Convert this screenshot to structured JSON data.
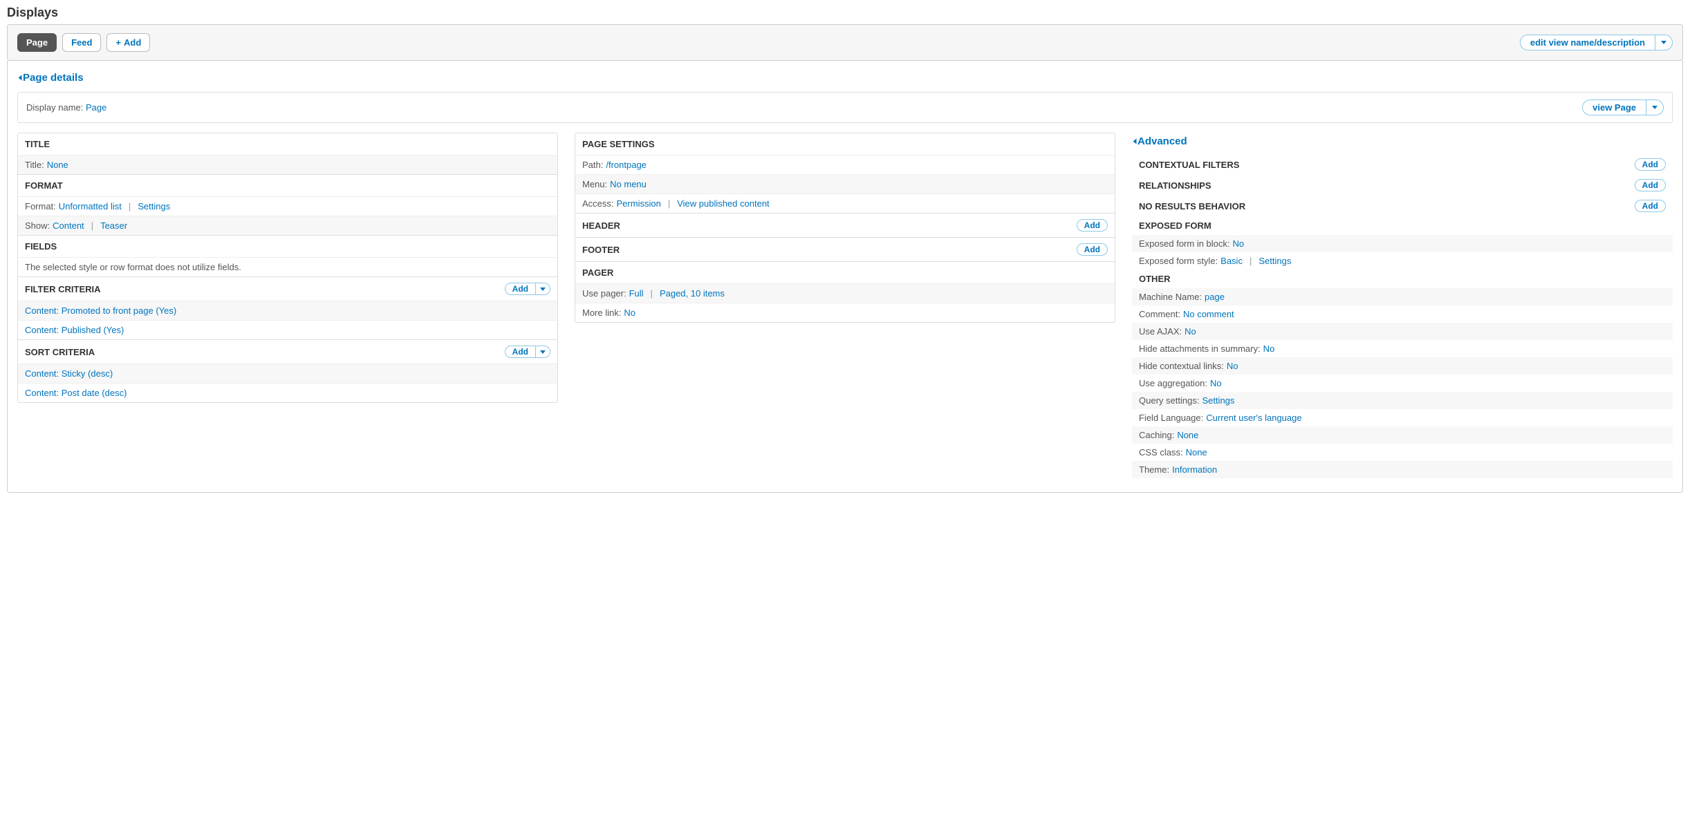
{
  "pageTitle": "Displays",
  "tabs": {
    "page": "Page",
    "feed": "Feed",
    "add": "Add"
  },
  "editViewBtn": "edit view name/description",
  "pageDetails": {
    "toggle": "Page details",
    "displayNameLabel": "Display name:",
    "displayNameValue": "Page",
    "viewPageBtn": "view Page"
  },
  "col1": {
    "title": {
      "head": "TITLE",
      "label": "Title:",
      "value": "None"
    },
    "format": {
      "head": "FORMAT",
      "formatLabel": "Format:",
      "formatValue": "Unformatted list",
      "formatSettings": "Settings",
      "showLabel": "Show:",
      "showValue": "Content",
      "showTeaser": "Teaser"
    },
    "fields": {
      "head": "FIELDS",
      "msg": "The selected style or row format does not utilize fields."
    },
    "filter": {
      "head": "FILTER CRITERIA",
      "addBtn": "Add",
      "item1": "Content: Promoted to front page (Yes)",
      "item2": "Content: Published (Yes)"
    },
    "sort": {
      "head": "SORT CRITERIA",
      "addBtn": "Add",
      "item1": "Content: Sticky (desc)",
      "item2": "Content: Post date (desc)"
    }
  },
  "col2": {
    "pageSettings": {
      "head": "PAGE SETTINGS",
      "pathLabel": "Path:",
      "pathValue": "/frontpage",
      "menuLabel": "Menu:",
      "menuValue": "No menu",
      "accessLabel": "Access:",
      "accessValue": "Permission",
      "accessPerm": "View published content"
    },
    "header": {
      "head": "HEADER",
      "addBtn": "Add"
    },
    "footer": {
      "head": "FOOTER",
      "addBtn": "Add"
    },
    "pager": {
      "head": "PAGER",
      "useLabel": "Use pager:",
      "useValue": "Full",
      "usePaged": "Paged, 10 items",
      "moreLabel": "More link:",
      "moreValue": "No"
    }
  },
  "col3": {
    "advanced": "Advanced",
    "contextual": {
      "head": "CONTEXTUAL FILTERS",
      "addBtn": "Add"
    },
    "relationships": {
      "head": "RELATIONSHIPS",
      "addBtn": "Add"
    },
    "noResults": {
      "head": "NO RESULTS BEHAVIOR",
      "addBtn": "Add"
    },
    "exposed": {
      "head": "EXPOSED FORM",
      "blockLabel": "Exposed form in block:",
      "blockValue": "No",
      "styleLabel": "Exposed form style:",
      "styleValue": "Basic",
      "styleSettings": "Settings"
    },
    "other": {
      "head": "OTHER",
      "machineLabel": "Machine Name:",
      "machineValue": "page",
      "commentLabel": "Comment:",
      "commentValue": "No comment",
      "ajaxLabel": "Use AJAX:",
      "ajaxValue": "No",
      "hideAttLabel": "Hide attachments in summary:",
      "hideAttValue": "No",
      "hideCtxLabel": "Hide contextual links:",
      "hideCtxValue": "No",
      "aggLabel": "Use aggregation:",
      "aggValue": "No",
      "queryLabel": "Query settings:",
      "queryValue": "Settings",
      "langLabel": "Field Language:",
      "langValue": "Current user's language",
      "cacheLabel": "Caching:",
      "cacheValue": "None",
      "cssLabel": "CSS class:",
      "cssValue": "None",
      "themeLabel": "Theme:",
      "themeValue": "Information"
    }
  }
}
